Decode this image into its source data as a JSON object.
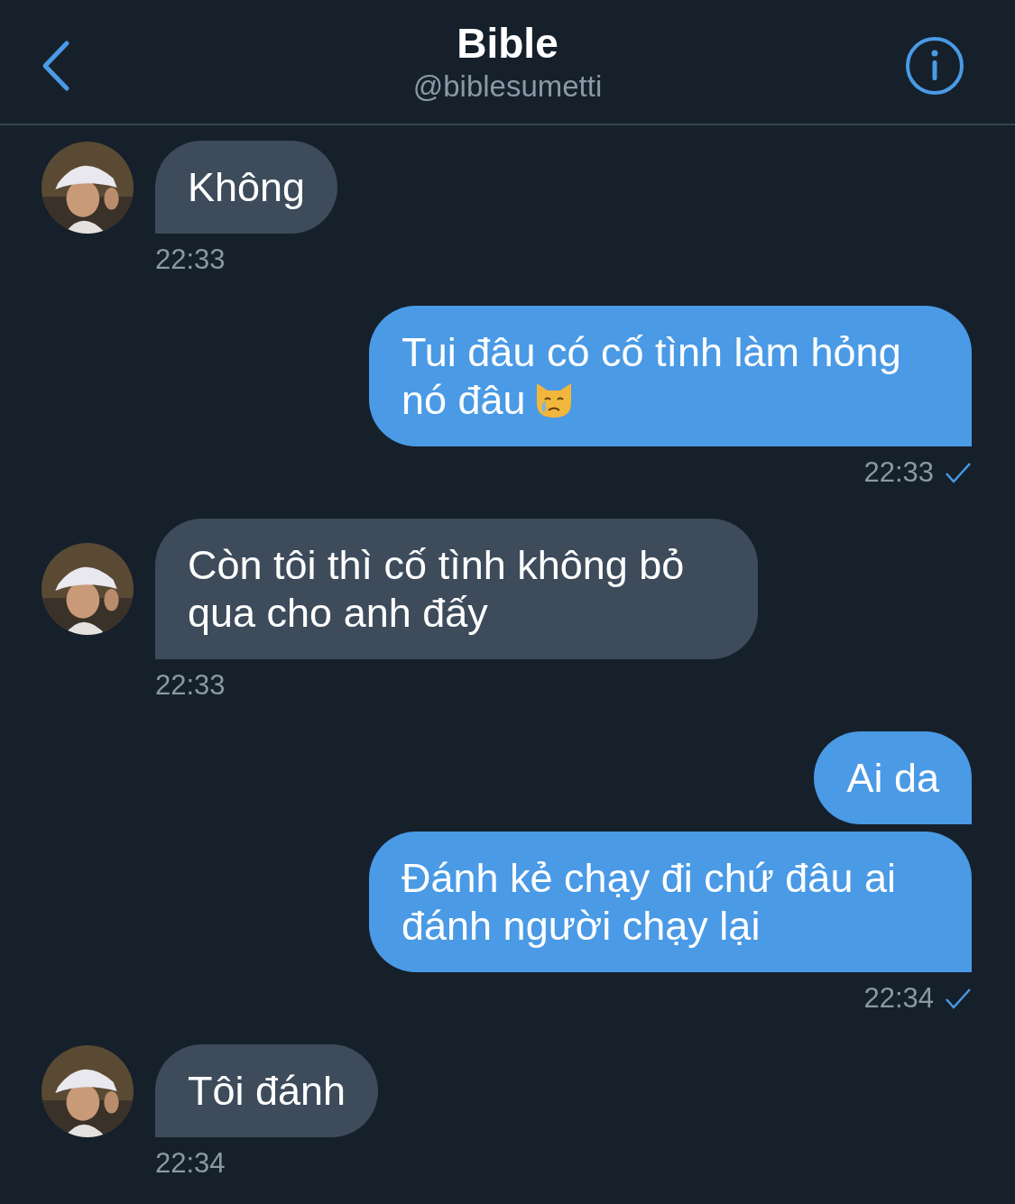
{
  "header": {
    "title": "Bible",
    "handle": "@biblesumetti"
  },
  "messages": [
    {
      "kind": "received",
      "text": "Không",
      "time": "22:33"
    },
    {
      "kind": "sent",
      "text": "Tui đâu có cố tình làm hỏng nó đâu",
      "trailing_icon": true,
      "time": "22:33",
      "read": true
    },
    {
      "kind": "received",
      "text": "Còn tôi thì cố tình không bỏ qua cho anh đấy",
      "time": "22:33"
    },
    {
      "kind": "sent",
      "text": "Ai da"
    },
    {
      "kind": "sent",
      "text": "Đánh kẻ chạy đi chứ đâu ai đánh người chạy lại",
      "time": "22:34",
      "read": true
    },
    {
      "kind": "received",
      "text": "Tôi đánh",
      "time": "22:34"
    }
  ]
}
